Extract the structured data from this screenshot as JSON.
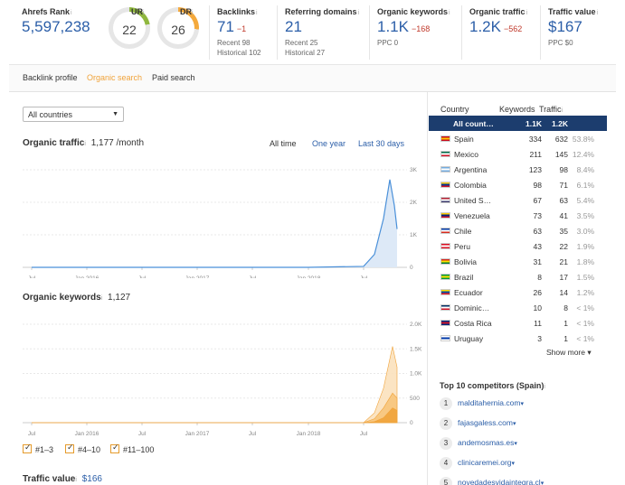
{
  "metrics": {
    "ahrefs_rank": {
      "label": "Ahrefs Rank",
      "value": "5,597,238"
    },
    "ur": {
      "label": "UR",
      "value": "22",
      "color": "#8fb73e"
    },
    "dr": {
      "label": "DR",
      "value": "26",
      "color": "#f4a93c"
    },
    "backlinks": {
      "label": "Backlinks",
      "value": "71",
      "delta": "−1",
      "recent": "Recent 98",
      "historical": "Historical 102"
    },
    "referring_domains": {
      "label": "Referring domains",
      "value": "21",
      "recent": "Recent 25",
      "historical": "Historical 27"
    },
    "organic_keywords": {
      "label": "Organic keywords",
      "value": "1.1K",
      "delta": "−168",
      "ppc": "PPC 0"
    },
    "organic_traffic": {
      "label": "Organic traffic",
      "value": "1.2K",
      "delta": "−562"
    },
    "traffic_value": {
      "label": "Traffic value",
      "value": "$167",
      "ppc": "PPC $0"
    }
  },
  "tabs": [
    "Backlink profile",
    "Organic search",
    "Paid search"
  ],
  "filter": {
    "selected": "All countries"
  },
  "organic_traffic_section": {
    "title": "Organic traffic",
    "value": "1,177 /month",
    "ranges": [
      "All time",
      "One year",
      "Last 30 days"
    ]
  },
  "organic_keywords_section": {
    "title": "Organic keywords",
    "value": "1,127",
    "legend": [
      "#1–3",
      "#4–10",
      "#11–100"
    ]
  },
  "traffic_value_section": {
    "title": "Traffic value",
    "value": "$166"
  },
  "chart_data": [
    {
      "type": "area",
      "x": [
        "Jul 2015",
        "Jan 2016",
        "Jul 2016",
        "Jan 2017",
        "Jul 2017",
        "Jan 2018",
        "Jul 2018",
        "Aug 2018",
        "Sep 2018",
        "Oct 2018",
        "Oct 2018",
        "Nov 2018"
      ],
      "values": [
        0,
        0,
        0,
        0,
        0,
        0,
        30,
        400,
        1500,
        2700,
        1900,
        1177
      ],
      "x_ticks": [
        "Jul",
        "Jan 2016",
        "Jul",
        "Jan 2017",
        "Jul",
        "Jan 2018",
        "Jul"
      ],
      "y_ticks": [
        "3K",
        "2K",
        "1K",
        "0"
      ],
      "ylim": [
        0,
        3000
      ],
      "colors": [
        "#4a90d9"
      ]
    },
    {
      "type": "area",
      "x": [
        "Jul 2015",
        "Jan 2016",
        "Jul 2016",
        "Jan 2017",
        "Jul 2017",
        "Jan 2018",
        "Jul 2018",
        "Aug 2018",
        "Sep 2018",
        "Oct 2018",
        "Nov 2018"
      ],
      "series": [
        {
          "name": "#11–100",
          "values": [
            0,
            0,
            0,
            0,
            0,
            0,
            0,
            200,
            700,
            1550,
            1127
          ],
          "color": "#fbe1bd"
        },
        {
          "name": "#4–10",
          "values": [
            0,
            0,
            0,
            0,
            0,
            0,
            0,
            80,
            300,
            600,
            500
          ],
          "color": "#f7c47b"
        },
        {
          "name": "#1–3",
          "values": [
            0,
            0,
            0,
            0,
            0,
            0,
            0,
            20,
            100,
            300,
            250
          ],
          "color": "#f0a33a"
        }
      ],
      "x_ticks": [
        "Jul",
        "Jan 2016",
        "Jul",
        "Jan 2017",
        "Jul",
        "Jan 2018",
        "Jul"
      ],
      "y_ticks": [
        "2.0K",
        "1.5K",
        "1.0K",
        "500",
        "0"
      ],
      "ylim": [
        0,
        2000
      ]
    }
  ],
  "countries": {
    "headers": {
      "country": "Country",
      "keywords": "Keywords",
      "traffic": "Traffic"
    },
    "rows": [
      {
        "name": "All count…",
        "kw": "1.1K",
        "tr": "1.2K",
        "pct": ""
      },
      {
        "name": "Spain",
        "kw": "334",
        "tr": "632",
        "pct": "53.8%",
        "flag": [
          "#c60b1e",
          "#ffc400",
          "#c60b1e"
        ]
      },
      {
        "name": "Mexico",
        "kw": "211",
        "tr": "145",
        "pct": "12.4%",
        "flag": [
          "#006847",
          "#ffffff",
          "#ce1126"
        ]
      },
      {
        "name": "Argentina",
        "kw": "123",
        "tr": "98",
        "pct": "8.4%",
        "flag": [
          "#74acdf",
          "#ffffff",
          "#74acdf"
        ]
      },
      {
        "name": "Colombia",
        "kw": "98",
        "tr": "71",
        "pct": "6.1%",
        "flag": [
          "#fcd116",
          "#003893",
          "#ce1126"
        ]
      },
      {
        "name": "United S…",
        "kw": "67",
        "tr": "63",
        "pct": "5.4%",
        "flag": [
          "#b22234",
          "#ffffff",
          "#3c3b6e"
        ]
      },
      {
        "name": "Venezuela",
        "kw": "73",
        "tr": "41",
        "pct": "3.5%",
        "flag": [
          "#ffcc00",
          "#00247d",
          "#cf142b"
        ]
      },
      {
        "name": "Chile",
        "kw": "63",
        "tr": "35",
        "pct": "3.0%",
        "flag": [
          "#0039a6",
          "#ffffff",
          "#d52b1e"
        ]
      },
      {
        "name": "Peru",
        "kw": "43",
        "tr": "22",
        "pct": "1.9%",
        "flag": [
          "#d91023",
          "#ffffff",
          "#d91023"
        ]
      },
      {
        "name": "Bolivia",
        "kw": "31",
        "tr": "21",
        "pct": "1.8%",
        "flag": [
          "#d52b1e",
          "#f9e300",
          "#007934"
        ]
      },
      {
        "name": "Brazil",
        "kw": "8",
        "tr": "17",
        "pct": "1.5%",
        "flag": [
          "#009c3b",
          "#ffdf00",
          "#009c3b"
        ]
      },
      {
        "name": "Ecuador",
        "kw": "26",
        "tr": "14",
        "pct": "1.2%",
        "flag": [
          "#ffdd00",
          "#034ea2",
          "#ed1c24"
        ]
      },
      {
        "name": "Dominic…",
        "kw": "10",
        "tr": "8",
        "pct": "< 1%",
        "flag": [
          "#002d62",
          "#ffffff",
          "#ce1126"
        ]
      },
      {
        "name": "Costa Rica",
        "kw": "11",
        "tr": "1",
        "pct": "< 1%",
        "flag": [
          "#002b7f",
          "#ce1126",
          "#002b7f"
        ]
      },
      {
        "name": "Uruguay",
        "kw": "3",
        "tr": "1",
        "pct": "< 1%",
        "flag": [
          "#ffffff",
          "#0038a8",
          "#ffffff"
        ]
      }
    ],
    "show_more": "Show more ▾"
  },
  "competitors": {
    "title": "Top 10 competitors (Spain)",
    "items": [
      {
        "num": "1",
        "domain": "malditahernia.com"
      },
      {
        "num": "2",
        "domain": "fajasgaless.com"
      },
      {
        "num": "3",
        "domain": "andemosmas.es"
      },
      {
        "num": "4",
        "domain": "clinicaremei.org"
      },
      {
        "num": "5",
        "domain": "novedadesvidaintegra.cl"
      }
    ]
  }
}
